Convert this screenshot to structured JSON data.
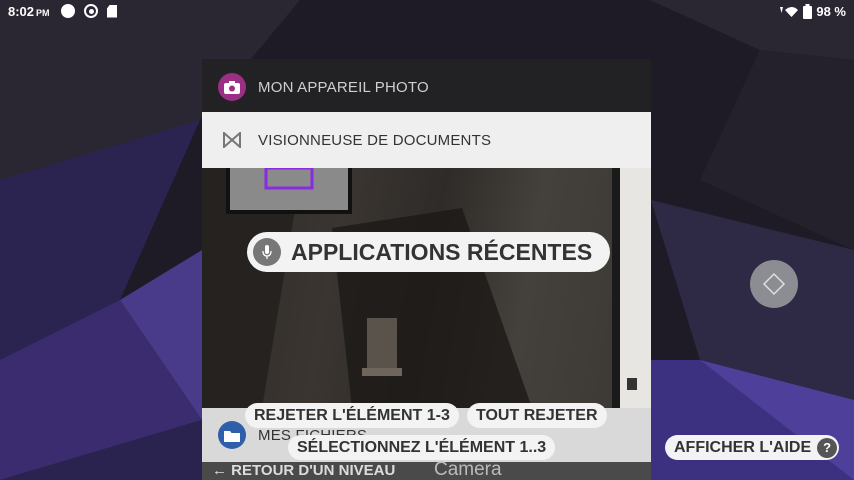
{
  "status": {
    "time": "8:02",
    "ampm": "PM",
    "battery": "98 %"
  },
  "cards": {
    "camera_title": "MON APPAREIL PHOTO",
    "docs_title": "VISIONNEUSE DE DOCUMENTS",
    "files_title": "MES FICHIERS",
    "back_label": "RETOUR D'UN NIVEAU",
    "camera_label": "Camera"
  },
  "overlay": {
    "recent_apps": "APPLICATIONS RÉCENTES",
    "dismiss_item": "REJETER L'ÉLÉMENT 1-3",
    "dismiss_all": "TOUT REJETER",
    "select_item": "SÉLECTIONNEZ L'ÉLÉMENT 1..3",
    "show_help": "AFFICHER L'AIDE",
    "help_symbol": "?"
  },
  "colors": {
    "camera_icon": "#9b2f86",
    "files_icon": "#2f5eaa",
    "selection_frame": "#8a2be2"
  },
  "icons": [
    "camera-icon",
    "document-viewer-icon",
    "folder-icon",
    "microphone-icon",
    "dpad-icon",
    "wifi-icon",
    "battery-icon"
  ]
}
